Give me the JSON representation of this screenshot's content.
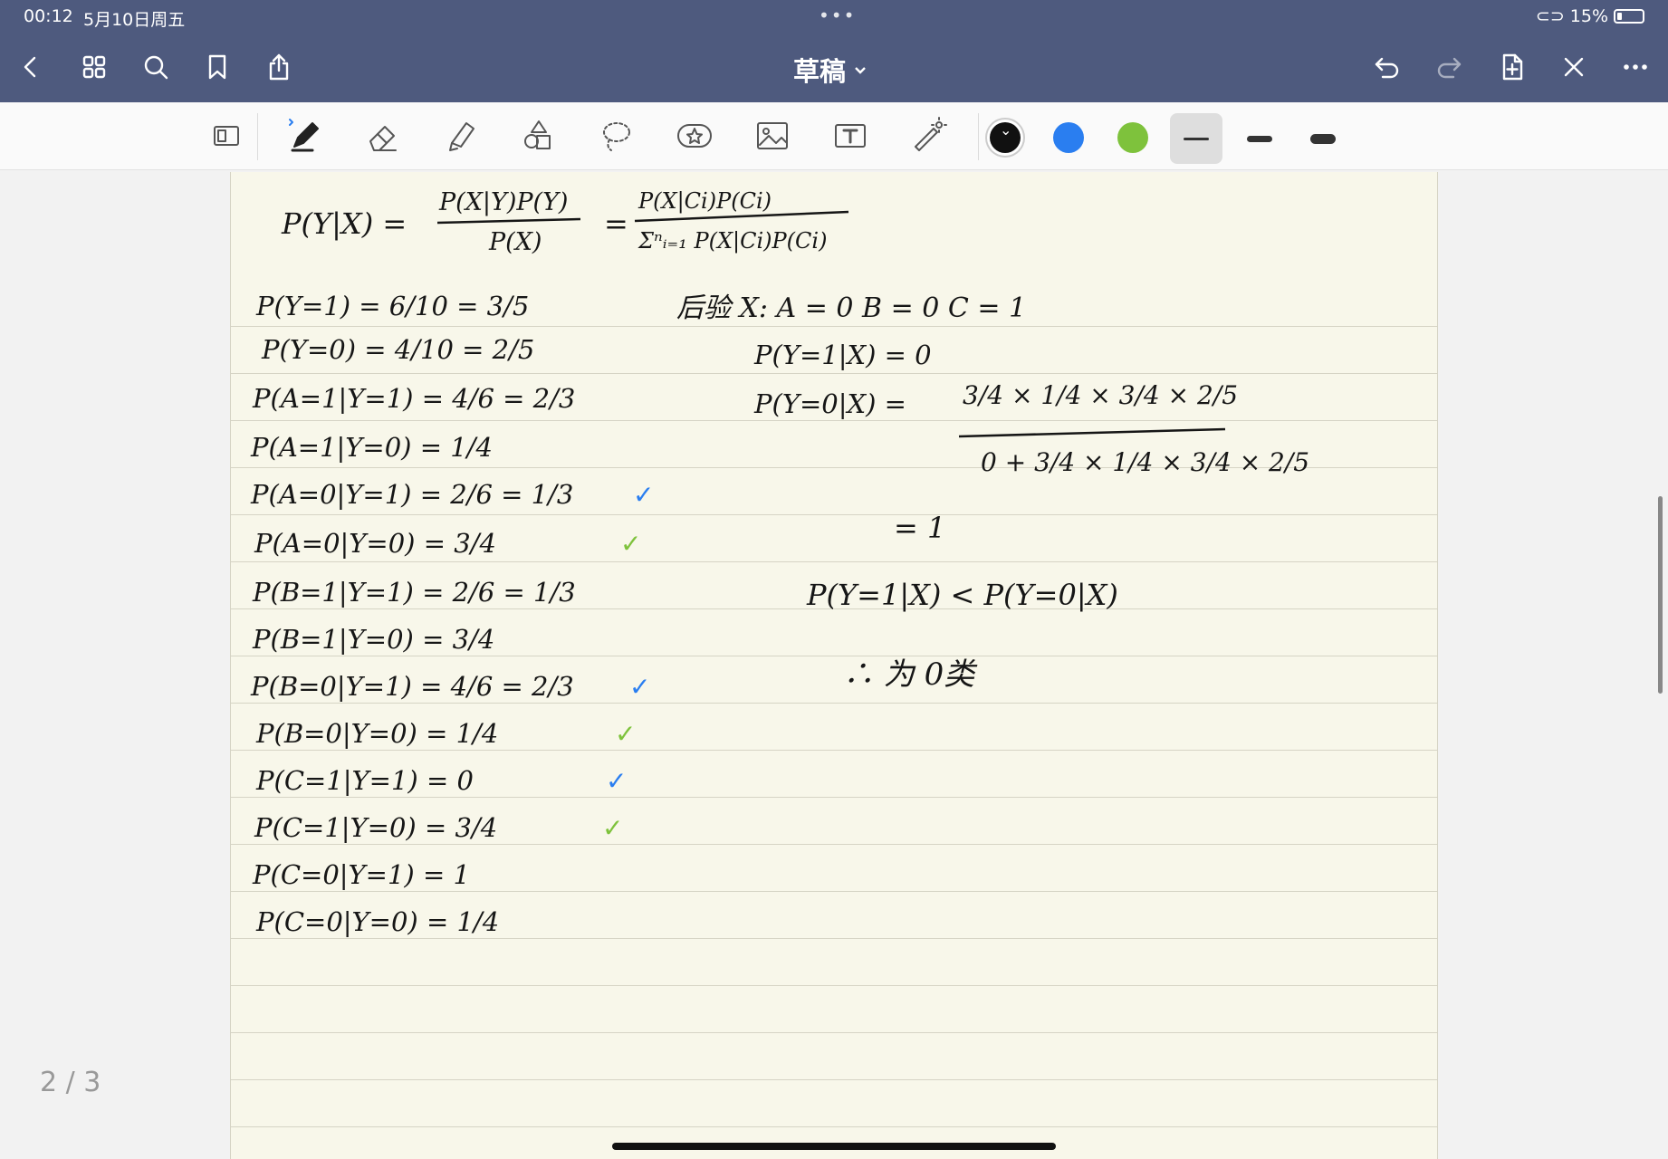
{
  "status": {
    "time": "00:12",
    "date": "5月10日周五",
    "battery": "15%"
  },
  "nav": {
    "title": "草稿"
  },
  "toolbar": {
    "tools": [
      "page-layout-icon",
      "pen-icon",
      "eraser-icon",
      "highlighter-icon",
      "shapes-icon",
      "lasso-icon",
      "sticker-icon",
      "image-icon",
      "text-icon",
      "laser-pointer-icon"
    ],
    "colors": {
      "black": "#111111",
      "blue": "#2a7ef0",
      "green": "#7ec23c"
    }
  },
  "notes": {
    "bayes_lhs": "P(Y|X) =",
    "bayes_num": "P(X|Y)P(Y)",
    "bayes_den": "P(X)",
    "bayes_eq": "=",
    "bayes_num2": "P(X|Ci)P(Ci)",
    "bayes_den2": "Σⁿᵢ₌₁ P(X|Ci)P(Ci)",
    "lines": [
      "P(Y=1) = 6/10 = 3/5",
      "P(Y=0) = 4/10 = 2/5",
      "P(A=1|Y=1) = 4/6 = 2/3",
      "P(A=1|Y=0) = 1/4",
      "P(A=0|Y=1) = 2/6 = 1/3",
      "P(A=0|Y=0) = 3/4",
      "P(B=1|Y=1) = 2/6 = 1/3",
      "P(B=1|Y=0) = 3/4",
      "P(B=0|Y=1) = 4/6 = 2/3",
      "P(B=0|Y=0) = 1/4",
      "P(C=1|Y=1) = 0",
      "P(C=1|Y=0) = 3/4",
      "P(C=0|Y=1) = 1",
      "P(C=0|Y=0) = 1/4"
    ],
    "check": "✓",
    "test_line": "后验   X: A = 0   B = 0   C = 1",
    "p1_line": "P(Y=1|X) = 0",
    "p0_lhs": "P(Y=0|X) =",
    "p0_num": "3/4 × 1/4 × 3/4 × 2/5",
    "p0_den": "0 + 3/4 × 1/4 × 3/4 × 2/5",
    "eq_one": "= 1",
    "compare": "P(Y=1|X) < P(Y=0|X)",
    "conclusion": "∴  为 0类"
  },
  "page_indicator": "2 / 3"
}
